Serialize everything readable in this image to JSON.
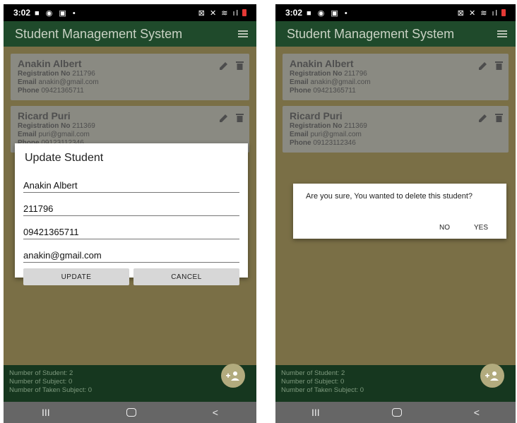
{
  "status_bar": {
    "time": "3:02"
  },
  "app": {
    "title": "Student Management System"
  },
  "students": [
    {
      "name": "Anakin Albert",
      "reg_label": "Registration No",
      "reg": "211796",
      "email_label": "Email",
      "email": "anakin@gmail.com",
      "phone_label": "Phone",
      "phone": "09421365711"
    },
    {
      "name": "Ricard Puri",
      "reg_label": "Registration No",
      "reg": "211369",
      "email_label": "Email",
      "email": "puri@gmail.com",
      "phone_label": "Phone",
      "phone": "09123112346"
    }
  ],
  "stats": {
    "students": "Number of Student: 2",
    "subjects": "Number of Subject: 0",
    "taken": "Number of Taken Subject: 0"
  },
  "update_dialog": {
    "title": "Update Student",
    "name_value": "Anakin Albert",
    "reg_value": "211796",
    "phone_value": "09421365711",
    "email_value": "anakin@gmail.com",
    "update_label": "UPDATE",
    "cancel_label": "CANCEL"
  },
  "confirm_dialog": {
    "message": "Are you sure, You wanted to delete this student?",
    "no_label": "NO",
    "yes_label": "YES"
  },
  "nav": {
    "recents": "III",
    "back": "<"
  },
  "colors": {
    "appbar": "#1f4a2b",
    "background": "#7a6f46",
    "fab": "#b2ab7e"
  }
}
